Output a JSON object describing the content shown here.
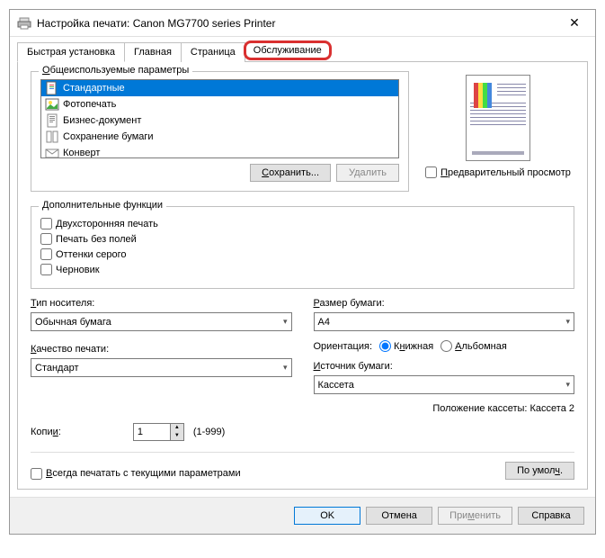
{
  "window": {
    "title": "Настройка печати: Canon MG7700 series Printer"
  },
  "tabs": {
    "quick": "Быстрая установка",
    "main": "Главная",
    "page": "Страница",
    "service": "Обслуживание"
  },
  "profiles": {
    "legend": "Общеиспользуемые параметры",
    "items": [
      {
        "label": "Стандартные",
        "selected": true
      },
      {
        "label": "Фотопечать",
        "selected": false
      },
      {
        "label": "Бизнес-документ",
        "selected": false
      },
      {
        "label": "Сохранение бумаги",
        "selected": false
      },
      {
        "label": "Конверт",
        "selected": false
      }
    ],
    "save_btn": "Сохранить...",
    "delete_btn": "Удалить",
    "preview_check": "Предварительный просмотр"
  },
  "addfunc": {
    "legend": "Дополнительные функции",
    "duplex": "Двухсторонняя печать",
    "borderless": "Печать без полей",
    "grayscale": "Оттенки серого",
    "draft": "Черновик"
  },
  "media": {
    "type_label": "Тип носителя:",
    "type_value": "Обычная бумага",
    "quality_label": "Качество печати:",
    "quality_value": "Стандарт"
  },
  "paper": {
    "size_label": "Размер бумаги:",
    "size_value": "A4",
    "orient_label": "Ориентация:",
    "orient_portrait": "Книжная",
    "orient_landscape": "Альбомная",
    "source_label": "Источник бумаги:",
    "source_value": "Кассета",
    "cassette_note": "Положение кассеты: Кассета 2"
  },
  "copies": {
    "label": "Копии:",
    "value": "1",
    "range": "(1-999)"
  },
  "always": {
    "label": "Всегда печатать с текущими параметрами",
    "defaults_btn": "По умолч."
  },
  "dialog": {
    "ok": "OK",
    "cancel": "Отмена",
    "apply": "Применить",
    "help": "Справка"
  }
}
